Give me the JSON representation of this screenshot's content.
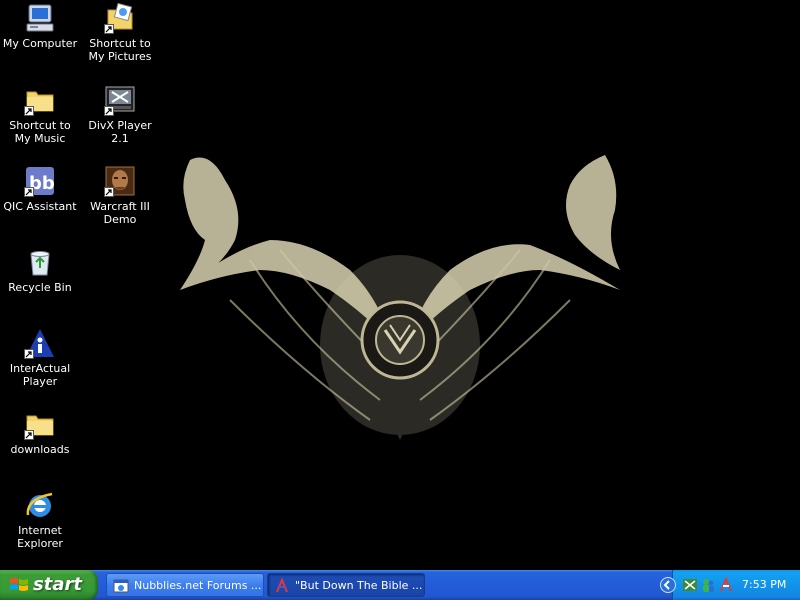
{
  "desktop": {
    "icons": [
      {
        "label": "My Computer",
        "icon": "my-computer-icon"
      },
      {
        "label": "Shortcut to My Pictures",
        "icon": "my-pictures-icon"
      },
      {
        "label": "Shortcut to My Music",
        "icon": "folder-icon"
      },
      {
        "label": "DivX Player 2.1",
        "icon": "divx-player-icon"
      },
      {
        "label": "QIC Assistant",
        "icon": "qic-assistant-icon"
      },
      {
        "label": "Warcraft III Demo",
        "icon": "warcraft-icon"
      },
      {
        "label": "Recycle Bin",
        "icon": "recycle-bin-icon"
      },
      {
        "label": "InterActual Player",
        "icon": "interactual-player-icon"
      },
      {
        "label": "downloads",
        "icon": "folder-icon"
      },
      {
        "label": "Internet Explorer",
        "icon": "internet-explorer-icon"
      }
    ]
  },
  "taskbar": {
    "start_label": "start",
    "tasks": [
      {
        "label": "Nubblies.net Forums ...",
        "icon": "browser-window-icon",
        "active": false
      },
      {
        "label": "\"But Down The Bible ...",
        "icon": "app-window-icon",
        "active": true
      }
    ],
    "tray_icons": [
      "network-icon",
      "messenger-icon",
      "app-icon"
    ],
    "clock": "7:53 PM"
  },
  "colors": {
    "taskbar_blue": "#245edb",
    "start_green": "#3c9c38",
    "tray_blue": "#1286e3",
    "desktop_bg": "#000000"
  }
}
